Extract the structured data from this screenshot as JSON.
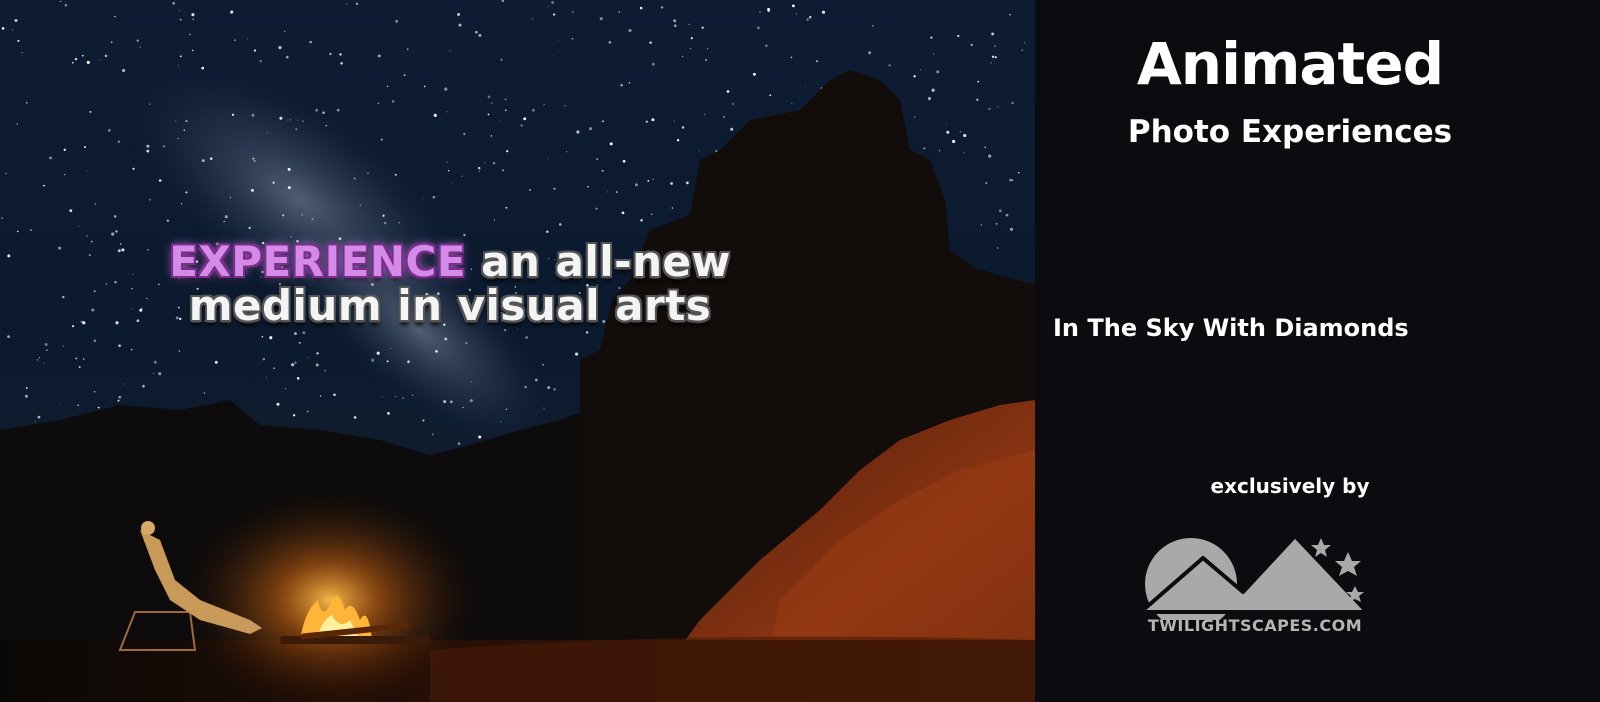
{
  "hero": {
    "accent_word": "EXPERIENCE",
    "line1_rest": " an all-new",
    "line2": "medium in visual arts"
  },
  "panel": {
    "title": "Animated",
    "subtitle": "Photo Experiences",
    "feature_title": "In The Sky With Diamonds",
    "byline": "exclusively by"
  },
  "logo": {
    "text": "TWILIGHTSCAPES.COM",
    "icon": "mountain-moon-stars-logo"
  },
  "colors": {
    "panel_background": "#0c0c10",
    "accent_purple": "#d58ae8",
    "logo_gray": "#b5b5b5",
    "fire_orange": "#ff9a2a"
  }
}
